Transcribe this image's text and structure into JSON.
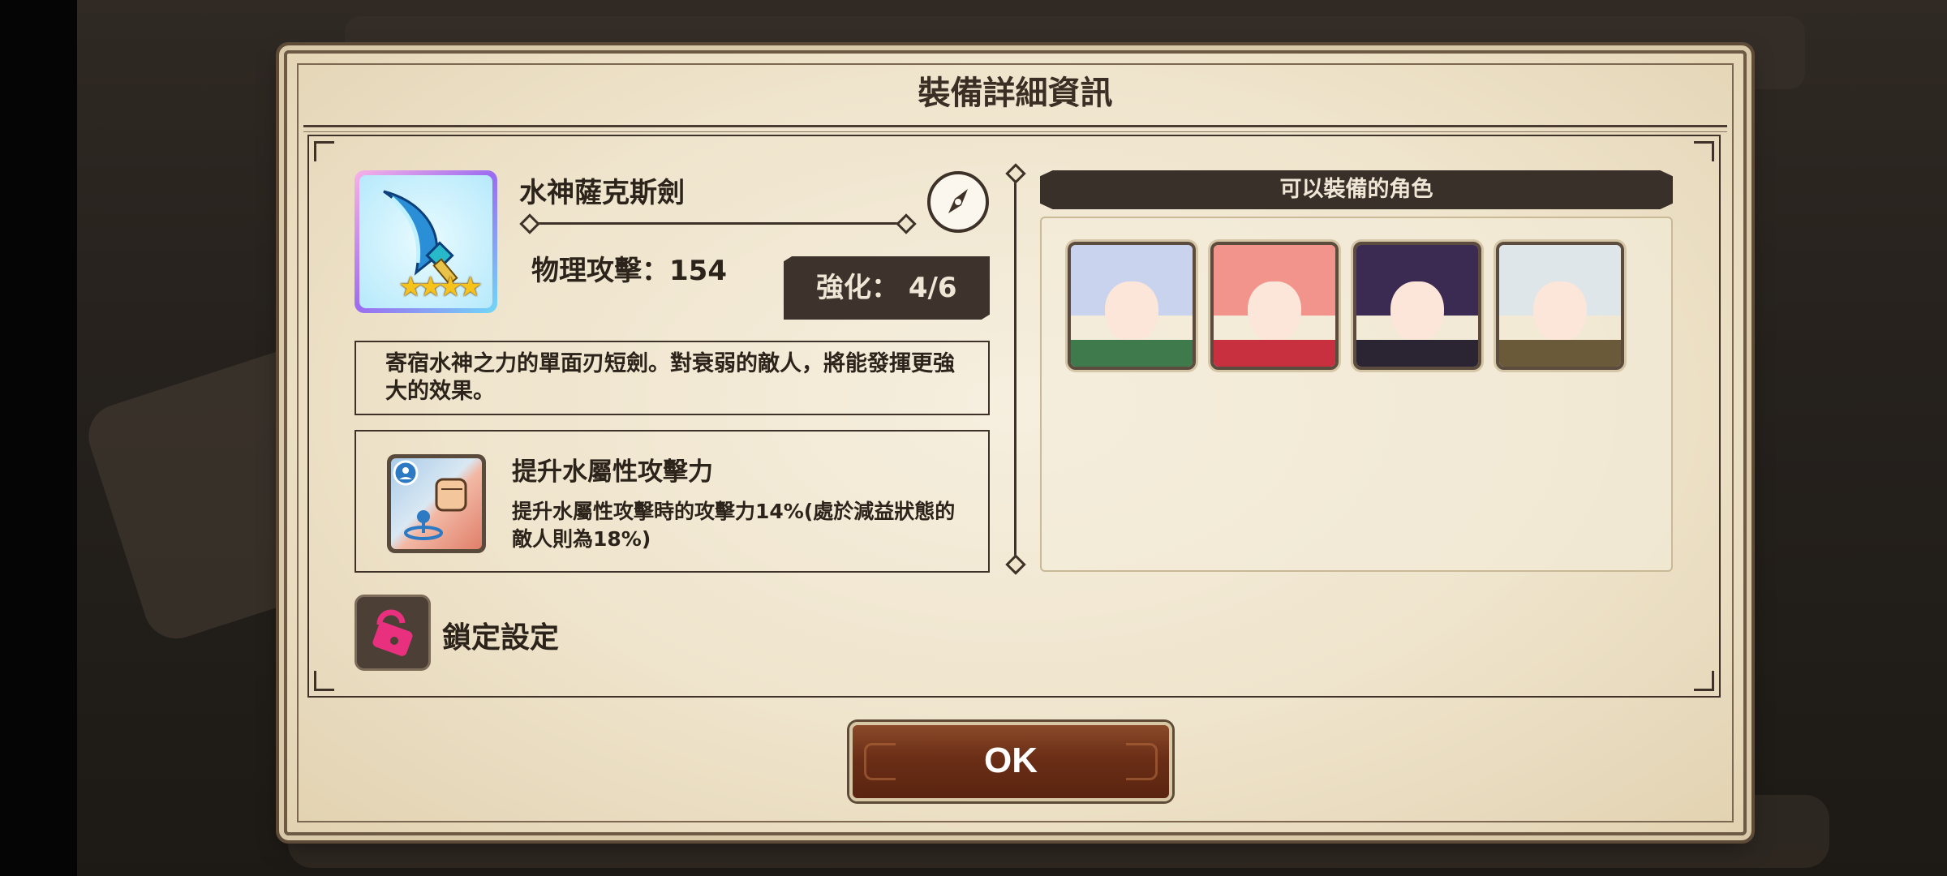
{
  "dialog": {
    "title": "裝備詳細資訊",
    "ok_label": "OK"
  },
  "item": {
    "name": "水神薩克斯劍",
    "attack_text": "物理攻擊：154",
    "enhance_text": "強化：  4/6",
    "stars": "★★★★",
    "description": "寄宿水神之力的單面刃短劍。對衰弱的敵人，將能發揮更強大的效果。"
  },
  "skill": {
    "title": "提升水屬性攻擊力",
    "description": "提升水屬性攻擊時的攻擊力14%(處於減益狀態的敵人則為18%)"
  },
  "lock": {
    "label": "鎖定設定"
  },
  "characters": {
    "header": "可以裝備的角色",
    "portraits": [
      {
        "name": "character-1",
        "hair": "#c9d3ee",
        "outfit": "#3f7a4c"
      },
      {
        "name": "character-2",
        "hair": "#f2948c",
        "outfit": "#c83040"
      },
      {
        "name": "character-3",
        "hair": "#3b2a52",
        "outfit": "#2b2433"
      },
      {
        "name": "character-4",
        "hair": "#dfe6ea",
        "outfit": "#6b5a3a"
      }
    ]
  }
}
